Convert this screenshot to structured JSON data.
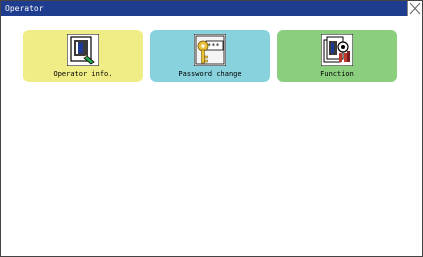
{
  "window": {
    "title": "Operator"
  },
  "tiles": [
    {
      "label": "Operator info.",
      "color": "#f0ec86",
      "icon": "operator-info-icon"
    },
    {
      "label": "Password change",
      "color": "#87d2dd",
      "icon": "password-key-icon"
    },
    {
      "label": "Function",
      "color": "#8bcf7e",
      "icon": "function-icon"
    }
  ]
}
